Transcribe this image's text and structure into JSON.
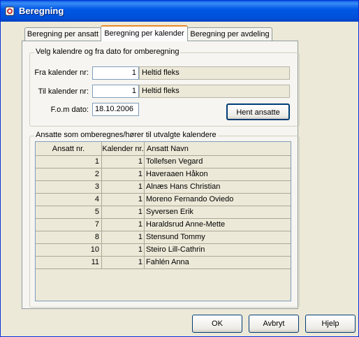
{
  "window": {
    "title": "Beregning"
  },
  "tabs": [
    {
      "label": "Beregning per ansatt"
    },
    {
      "label": "Beregning per kalender"
    },
    {
      "label": "Beregning per avdeling"
    }
  ],
  "calendar_group": {
    "legend": "Velg kalendre og fra dato for omberegning",
    "fra_label": "Fra kalender nr:",
    "fra_value": "1",
    "fra_name": "Heltid fleks",
    "til_label": "Til kalender nr:",
    "til_value": "1",
    "til_name": "Heltid fleks",
    "dato_label": "F.o.m dato:",
    "dato_value": "18.10.2006",
    "fetch_button": "Hent ansatte"
  },
  "employees_group": {
    "legend": "Ansatte som omberegnes/hører til utvalgte kalendere",
    "columns": [
      "Ansatt nr.",
      "Kalender nr.",
      "Ansatt Navn"
    ],
    "rows": [
      {
        "nr": "1",
        "kal": "1",
        "navn": "Tollefsen Vegard"
      },
      {
        "nr": "2",
        "kal": "1",
        "navn": "Haveraaen Håkon"
      },
      {
        "nr": "3",
        "kal": "1",
        "navn": "Alnæs Hans Christian"
      },
      {
        "nr": "4",
        "kal": "1",
        "navn": "Moreno Fernando Oviedo"
      },
      {
        "nr": "5",
        "kal": "1",
        "navn": "Syversen Erik"
      },
      {
        "nr": "7",
        "kal": "1",
        "navn": "Haraldsrud Anne-Mette"
      },
      {
        "nr": "8",
        "kal": "1",
        "navn": "Stensund Tommy"
      },
      {
        "nr": "10",
        "kal": "1",
        "navn": "Steiro Lill-Cathrin"
      },
      {
        "nr": "11",
        "kal": "1",
        "navn": "Fahlén Anna"
      }
    ]
  },
  "footer": {
    "ok": "OK",
    "cancel": "Avbryt",
    "help": "Hjelp"
  }
}
